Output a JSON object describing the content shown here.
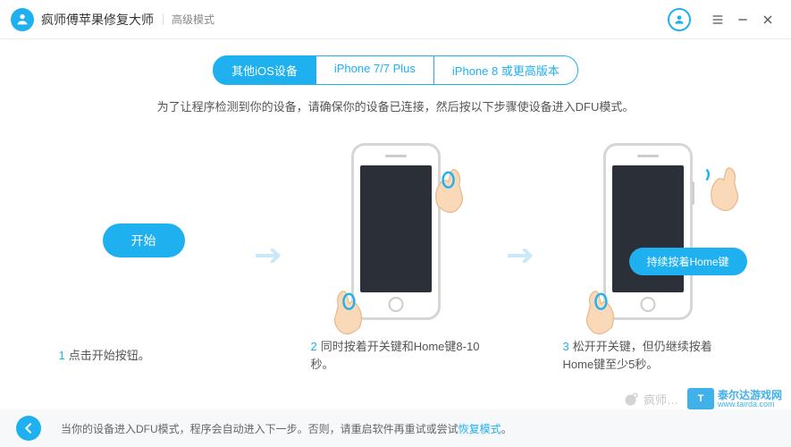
{
  "titlebar": {
    "title": "疯师傅苹果修复大师",
    "mode": "高级模式"
  },
  "tabs": {
    "items": [
      {
        "label": "其他iOS设备",
        "active": true
      },
      {
        "label": "iPhone 7/7 Plus",
        "active": false
      },
      {
        "label": "iPhone 8 或更高版本",
        "active": false
      }
    ]
  },
  "subtitle": "为了让程序检测到你的设备，请确保你的设备已连接，然后按以下步骤使设备进入DFU模式。",
  "steps": {
    "start_button": "开始",
    "hold_home_label": "持续按着Home键",
    "s1": {
      "num": "1",
      "text": "点击开始按钮。"
    },
    "s2": {
      "num": "2",
      "text": "同时按着开关键和Home键8-10秒。"
    },
    "s3": {
      "num": "3",
      "text": "松开开关键，但仍继续按着Home键至少5秒。"
    }
  },
  "footer": {
    "text_before": "当你的设备进入DFU模式，程序会自动进入下一步。否则，请重启软件再重试或尝试",
    "link": "恢复模式",
    "text_after": "。"
  },
  "watermark": {
    "weibo": "疯师…",
    "site_cn": "泰尔达游戏网",
    "site_en": "www.tairda.com"
  }
}
